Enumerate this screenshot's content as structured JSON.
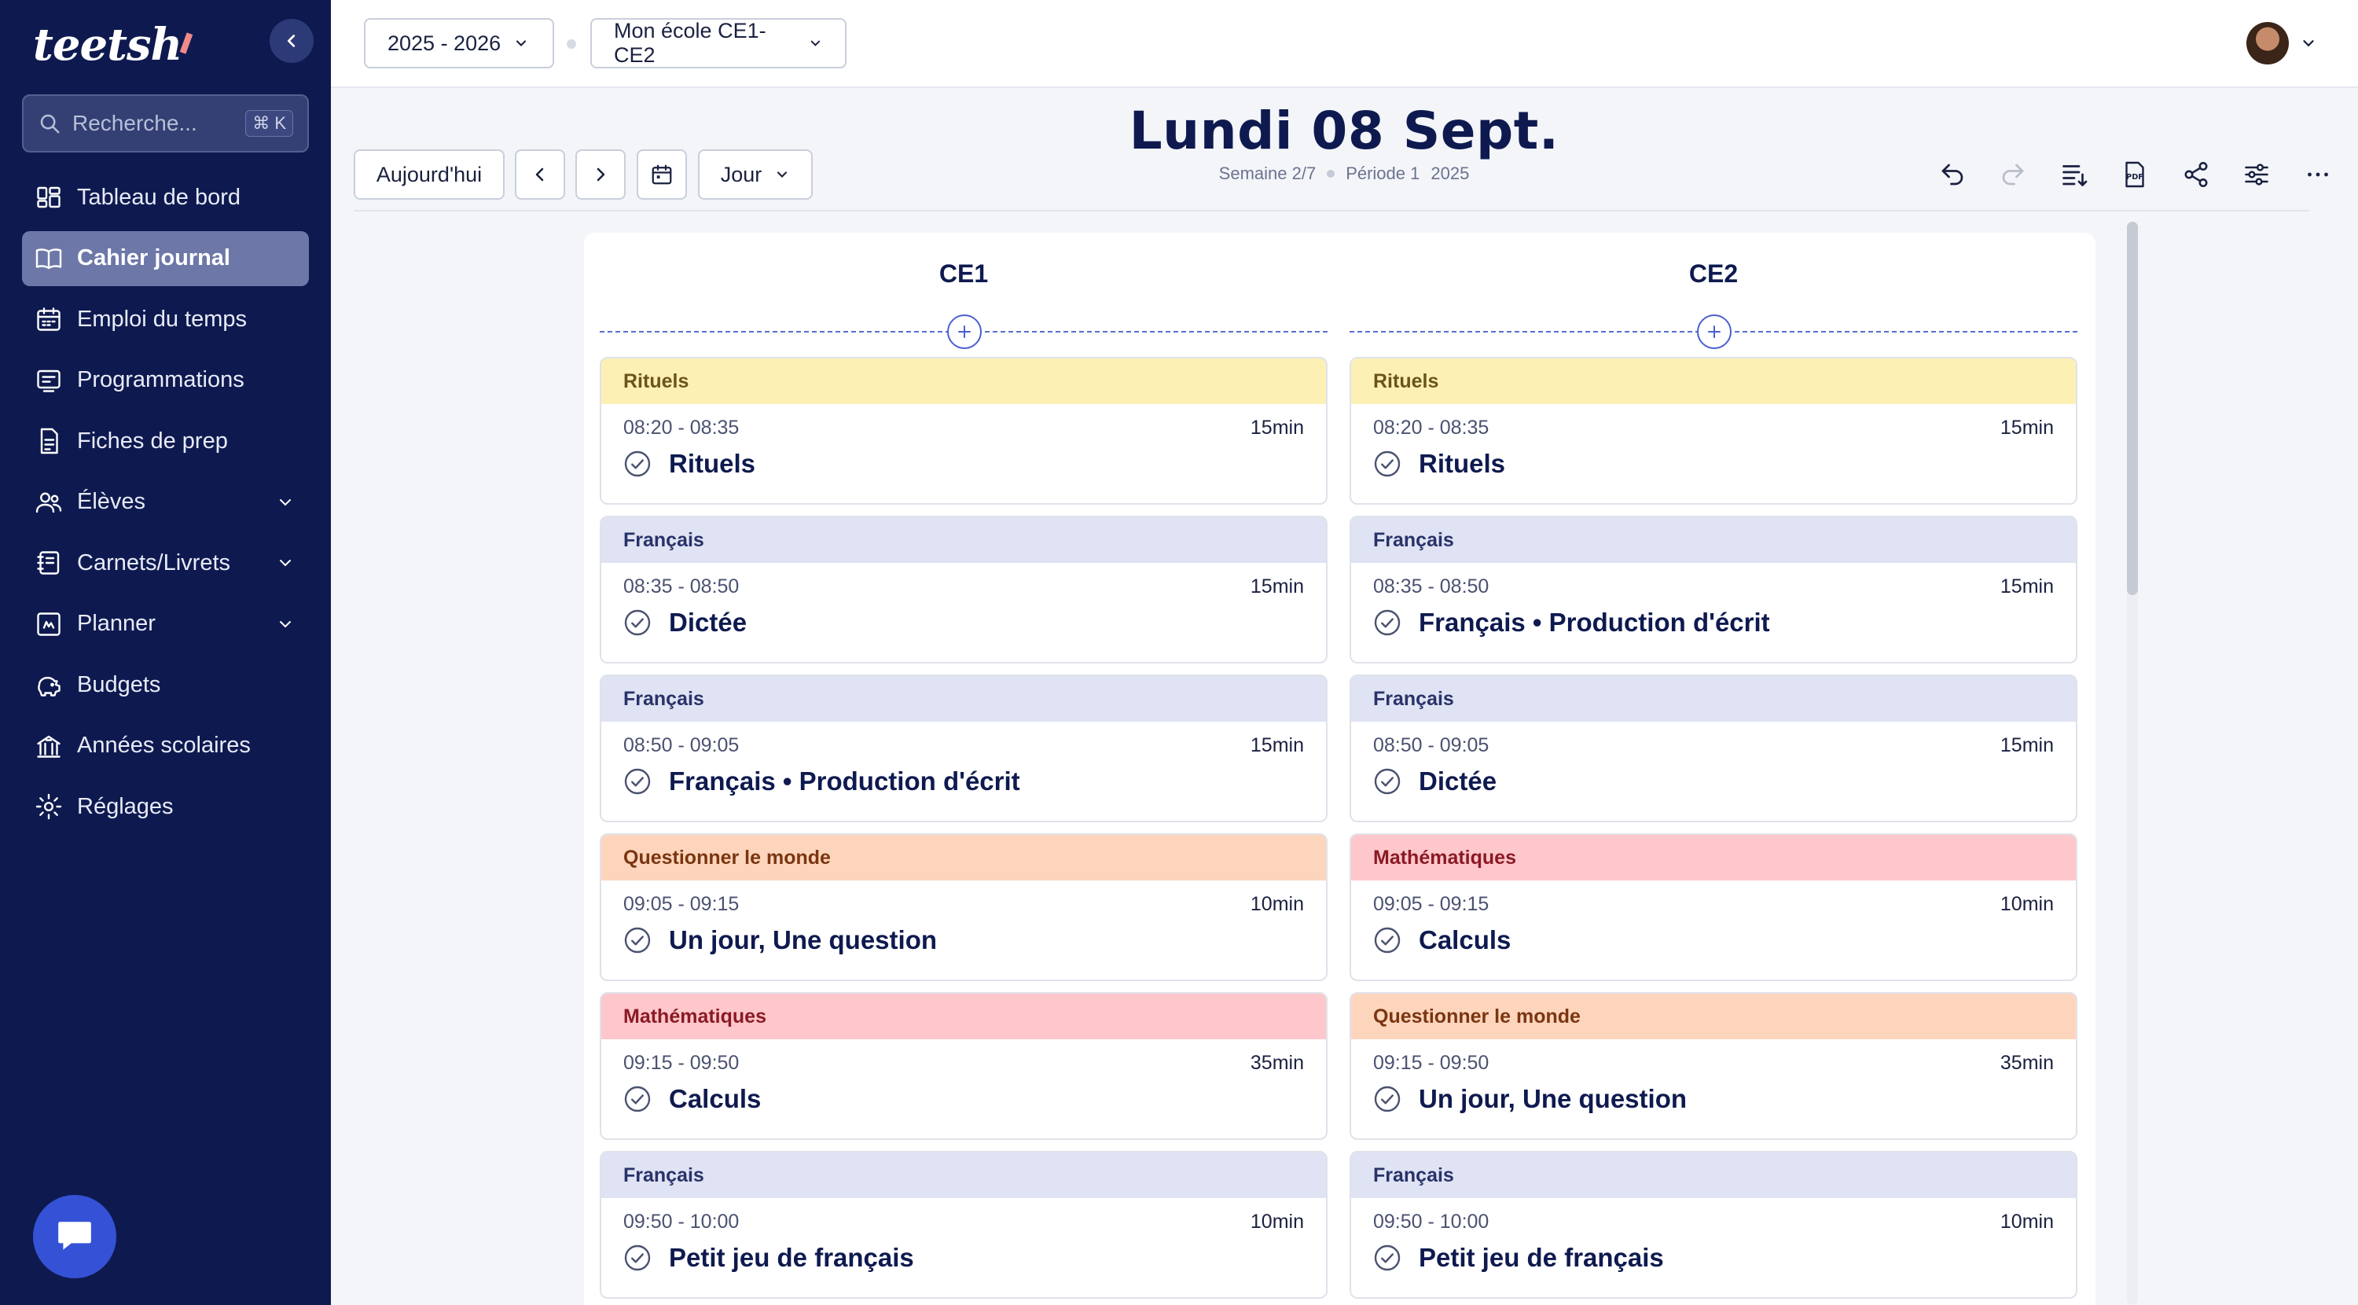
{
  "sidebar": {
    "logo": "teetsh",
    "search_placeholder": "Recherche...",
    "search_shortcut": "⌘ K",
    "items": [
      {
        "label": "Tableau de bord",
        "icon": "dashboard-icon"
      },
      {
        "label": "Cahier journal",
        "icon": "book-open-icon",
        "active": true
      },
      {
        "label": "Emploi du temps",
        "icon": "calendar-icon"
      },
      {
        "label": "Programmations",
        "icon": "list-board-icon"
      },
      {
        "label": "Fiches de prep",
        "icon": "document-icon"
      },
      {
        "label": "Élèves",
        "icon": "users-icon",
        "expandable": true
      },
      {
        "label": "Carnets/Livrets",
        "icon": "notebook-icon",
        "expandable": true
      },
      {
        "label": "Planner",
        "icon": "planner-icon",
        "expandable": true
      },
      {
        "label": "Budgets",
        "icon": "piggy-bank-icon"
      },
      {
        "label": "Années scolaires",
        "icon": "school-icon"
      },
      {
        "label": "Réglages",
        "icon": "gear-icon"
      }
    ]
  },
  "topbar": {
    "year_select": "2025 - 2026",
    "school_select": "Mon école CE1-CE2"
  },
  "toolbar": {
    "today_label": "Aujourd'hui",
    "view_select": "Jour",
    "title": "Lundi 08 Sept.",
    "week": "Semaine 2/7",
    "period": "Période 1",
    "year": "2025"
  },
  "columns": [
    {
      "name": "CE1",
      "cards": [
        {
          "subject": "Rituels",
          "type": "rituels",
          "time": "08:20 - 08:35",
          "duration": "15min",
          "title": "Rituels"
        },
        {
          "subject": "Français",
          "type": "francais",
          "time": "08:35 - 08:50",
          "duration": "15min",
          "title": "Dictée"
        },
        {
          "subject": "Français",
          "type": "francais",
          "time": "08:50 - 09:05",
          "duration": "15min",
          "title": "Français • Production d'écrit"
        },
        {
          "subject": "Questionner le monde",
          "type": "monde",
          "time": "09:05 - 09:15",
          "duration": "10min",
          "title": "Un jour, Une question"
        },
        {
          "subject": "Mathématiques",
          "type": "maths",
          "time": "09:15 - 09:50",
          "duration": "35min",
          "title": "Calculs"
        },
        {
          "subject": "Français",
          "type": "francais",
          "time": "09:50 - 10:00",
          "duration": "10min",
          "title": "Petit jeu de français"
        }
      ]
    },
    {
      "name": "CE2",
      "cards": [
        {
          "subject": "Rituels",
          "type": "rituels",
          "time": "08:20 - 08:35",
          "duration": "15min",
          "title": "Rituels"
        },
        {
          "subject": "Français",
          "type": "francais",
          "time": "08:35 - 08:50",
          "duration": "15min",
          "title": "Français • Production d'écrit"
        },
        {
          "subject": "Français",
          "type": "francais",
          "time": "08:50 - 09:05",
          "duration": "15min",
          "title": "Dictée"
        },
        {
          "subject": "Mathématiques",
          "type": "maths",
          "time": "09:05 - 09:15",
          "duration": "10min",
          "title": "Calculs"
        },
        {
          "subject": "Questionner le monde",
          "type": "monde",
          "time": "09:15 - 09:50",
          "duration": "35min",
          "title": "Un jour, Une question"
        },
        {
          "subject": "Français",
          "type": "francais",
          "time": "09:50 - 10:00",
          "duration": "10min",
          "title": "Petit jeu de français"
        }
      ]
    }
  ],
  "colors": {
    "sidebar_bg": "#0e1a4f",
    "rituels": "#fdf0b5",
    "francais": "#dfe3f3",
    "monde": "#fdd5bd",
    "maths": "#fec7cb",
    "accent": "#3552d6"
  }
}
